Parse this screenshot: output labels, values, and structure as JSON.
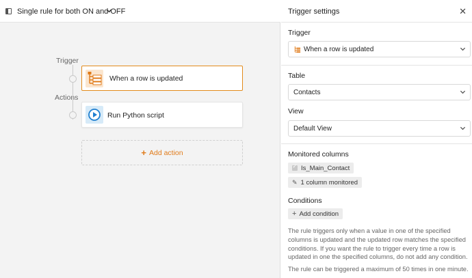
{
  "rule": {
    "title": "Single rule for both ON and OFF"
  },
  "flow": {
    "trigger_label": "Trigger",
    "actions_label": "Actions",
    "trigger_card": "When a row is updated",
    "action_card": "Run Python script",
    "add_action": "Add action"
  },
  "settings": {
    "title": "Trigger settings",
    "trigger_label": "Trigger",
    "trigger_value": "When a row is updated",
    "table_label": "Table",
    "table_value": "Contacts",
    "view_label": "View",
    "view_value": "Default View",
    "monitored_label": "Monitored columns",
    "monitored_column": "Is_Main_Contact",
    "monitored_count": "1 column monitored",
    "conditions_label": "Conditions",
    "add_condition": "Add condition",
    "help_text": "The rule triggers only when a value in one of the specified columns is updated and the updated row matches the specified conditions. If you want the rule to trigger every time a row is updated in one the specified columns, do not add any condition.",
    "limit_text": "The rule can be triggered a maximum of 50 times in one minute."
  },
  "colors": {
    "accent": "#e07b1a",
    "trigger_border": "#e38a1a",
    "action_icon_bg": "#d6eaf8"
  },
  "icons": [
    "sidebar-toggle-icon",
    "chevron-down-icon",
    "trigger-tree-icon",
    "play-icon",
    "plus-icon",
    "close-icon",
    "pencil-icon",
    "checkbox-icon"
  ]
}
